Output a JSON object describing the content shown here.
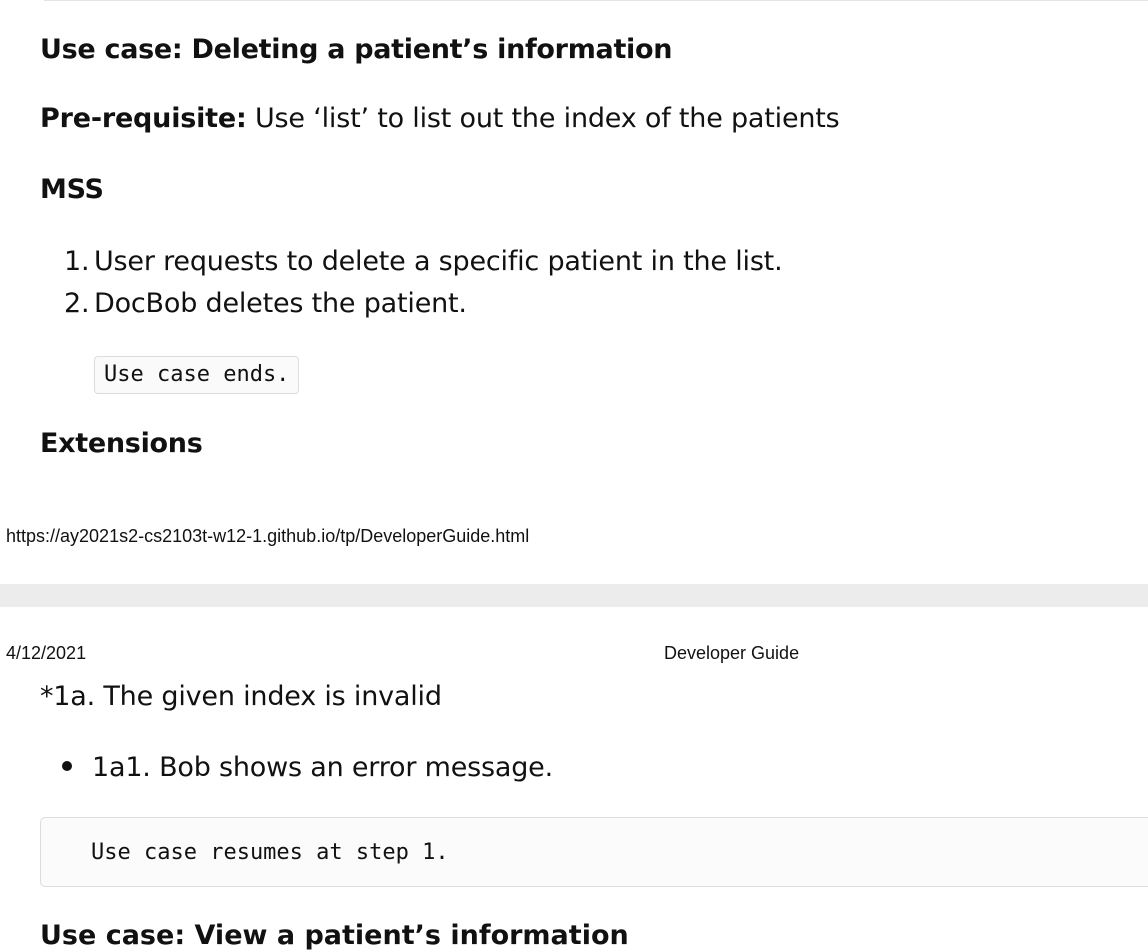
{
  "page1": {
    "use_case_heading": "Use case: Deleting a patient’s information",
    "prerequisite_label": "Pre-requisite:",
    "prerequisite_text": " Use ‘list’ to list out the index of the patients",
    "mss_heading": "MSS",
    "steps": [
      {
        "number": "1.",
        "text": "User requests to delete a specific patient in the list."
      },
      {
        "number": "2.",
        "text": "DocBob deletes the patient."
      }
    ],
    "use_case_end_code": "Use case ends.",
    "extensions_heading": "Extensions",
    "footer_url": "https://ay2021s2-cs2103t-w12-1.github.io/tp/DeveloperGuide.html"
  },
  "page2": {
    "header_date": "4/12/2021",
    "header_title": "Developer Guide",
    "extension_condition": "*1a. The given index is invalid",
    "extension_step": "1a1. Bob shows an error message.",
    "resume_code": "Use case resumes at step 1.",
    "next_heading_partial": "Use case: View a patient’s information"
  }
}
